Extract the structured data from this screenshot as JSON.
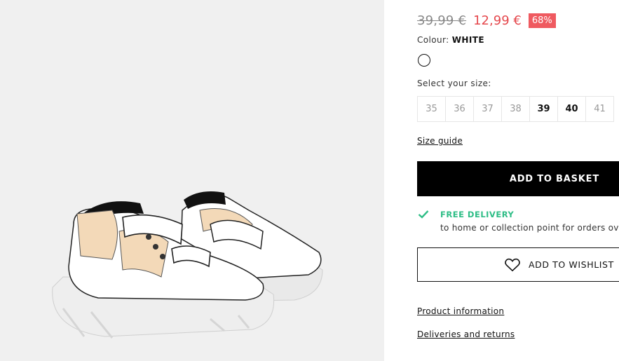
{
  "product": {
    "image_alt": "white chunky sneakers",
    "old_price": "39,99 €",
    "new_price": "12,99 €",
    "discount": "68%"
  },
  "colour": {
    "label": "Colour: ",
    "value": "WHITE",
    "swatch_color": "#ffffff"
  },
  "sizes": {
    "label": "Select your size:",
    "options": [
      {
        "label": "35",
        "available": false
      },
      {
        "label": "36",
        "available": false
      },
      {
        "label": "37",
        "available": false
      },
      {
        "label": "38",
        "available": false
      },
      {
        "label": "39",
        "available": true
      },
      {
        "label": "40",
        "available": true
      },
      {
        "label": "41",
        "available": false
      }
    ],
    "guide_label": "Size guide"
  },
  "actions": {
    "add_to_basket": "ADD TO BASKET",
    "add_to_wishlist": "ADD TO WISHLIST"
  },
  "delivery": {
    "title": "FREE DELIVERY",
    "description": "to home or collection point for orders ove",
    "icon": "check-icon",
    "color": "#2ebd86"
  },
  "links": {
    "product_information": "Product information",
    "deliveries_returns": "Deliveries and returns"
  },
  "colors": {
    "sale": "#e5484d",
    "badge": "#ef5a60"
  }
}
